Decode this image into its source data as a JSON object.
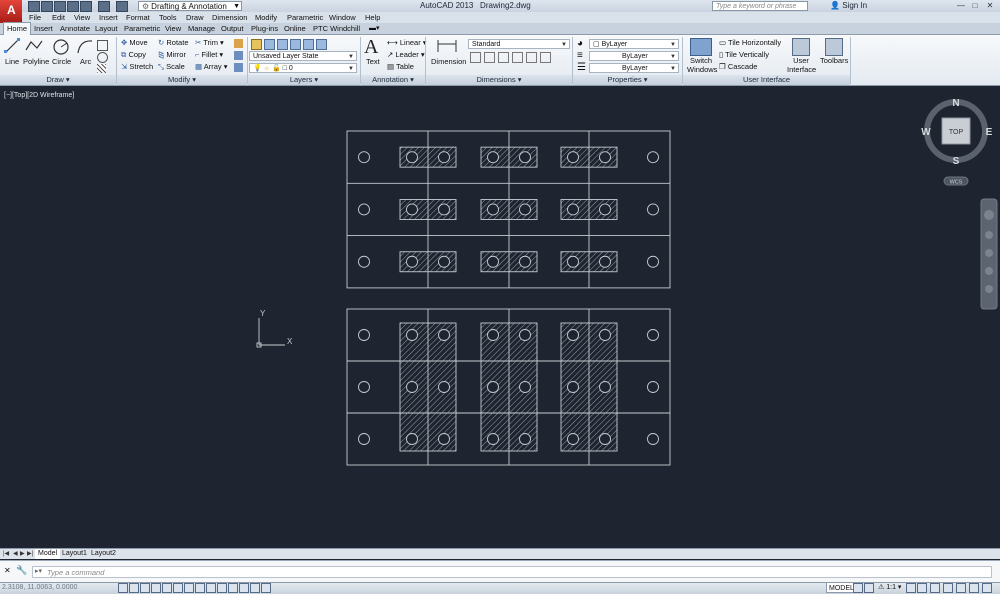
{
  "app": {
    "title": "AutoCAD 2013",
    "document": "Drawing2.dwg",
    "workspace": "Drafting & Annotation",
    "search_placeholder": "Type a keyword or phrase",
    "sign_in": "Sign In"
  },
  "menu": [
    "File",
    "Edit",
    "View",
    "Insert",
    "Format",
    "Tools",
    "Draw",
    "Dimension",
    "Modify",
    "Parametric",
    "Window",
    "Help"
  ],
  "ribbon_tabs": [
    "Home",
    "Insert",
    "Annotate",
    "Layout",
    "Parametric",
    "View",
    "Manage",
    "Output",
    "Plug-ins",
    "Online",
    "PTC Windchill"
  ],
  "ribbon": {
    "draw": {
      "title": "Draw",
      "tools": [
        "Line",
        "Polyline",
        "Circle",
        "Arc"
      ]
    },
    "modify": {
      "title": "Modify",
      "tools": [
        "Move",
        "Rotate",
        "Trim",
        "Copy",
        "Mirror",
        "Fillet",
        "Stretch",
        "Scale",
        "Array"
      ]
    },
    "layers": {
      "title": "Layers",
      "layer_state": "Unsaved Layer State",
      "current_layer": "0"
    },
    "annotation": {
      "title": "Annotation",
      "text": "Text",
      "tools": [
        "Linear",
        "Leader",
        "Table"
      ]
    },
    "dimensions": {
      "title": "Dimensions",
      "dimension": "Dimension",
      "style": "Standard"
    },
    "properties": {
      "title": "Properties",
      "color": "ByLayer",
      "linetype": "ByLayer",
      "lineweight": "ByLayer"
    },
    "user_interface": {
      "title": "User Interface",
      "switch": "Switch Windows",
      "tools": [
        "Tile Horizontally",
        "Tile Vertically",
        "Cascade"
      ],
      "user_interface": "User Interface",
      "toolbars": "Toolbars"
    }
  },
  "viewport_label": "[−][Top][2D Wireframe]",
  "viewcube": {
    "face": "TOP",
    "north": "N",
    "south": "S",
    "east": "E",
    "west": "W",
    "wcs": "WCS"
  },
  "ucs": {
    "x": "X",
    "y": "Y"
  },
  "layout_tabs": [
    "Model",
    "Layout1",
    "Layout2"
  ],
  "command_placeholder": "Type a command",
  "status": {
    "coords": "2.3108, 11.0063, 0.0000",
    "model": "MODEL",
    "scale": "1:1"
  },
  "colors": {
    "background": "#1e2430",
    "lines": "#c8ccd2",
    "accent": "#e2453b"
  }
}
